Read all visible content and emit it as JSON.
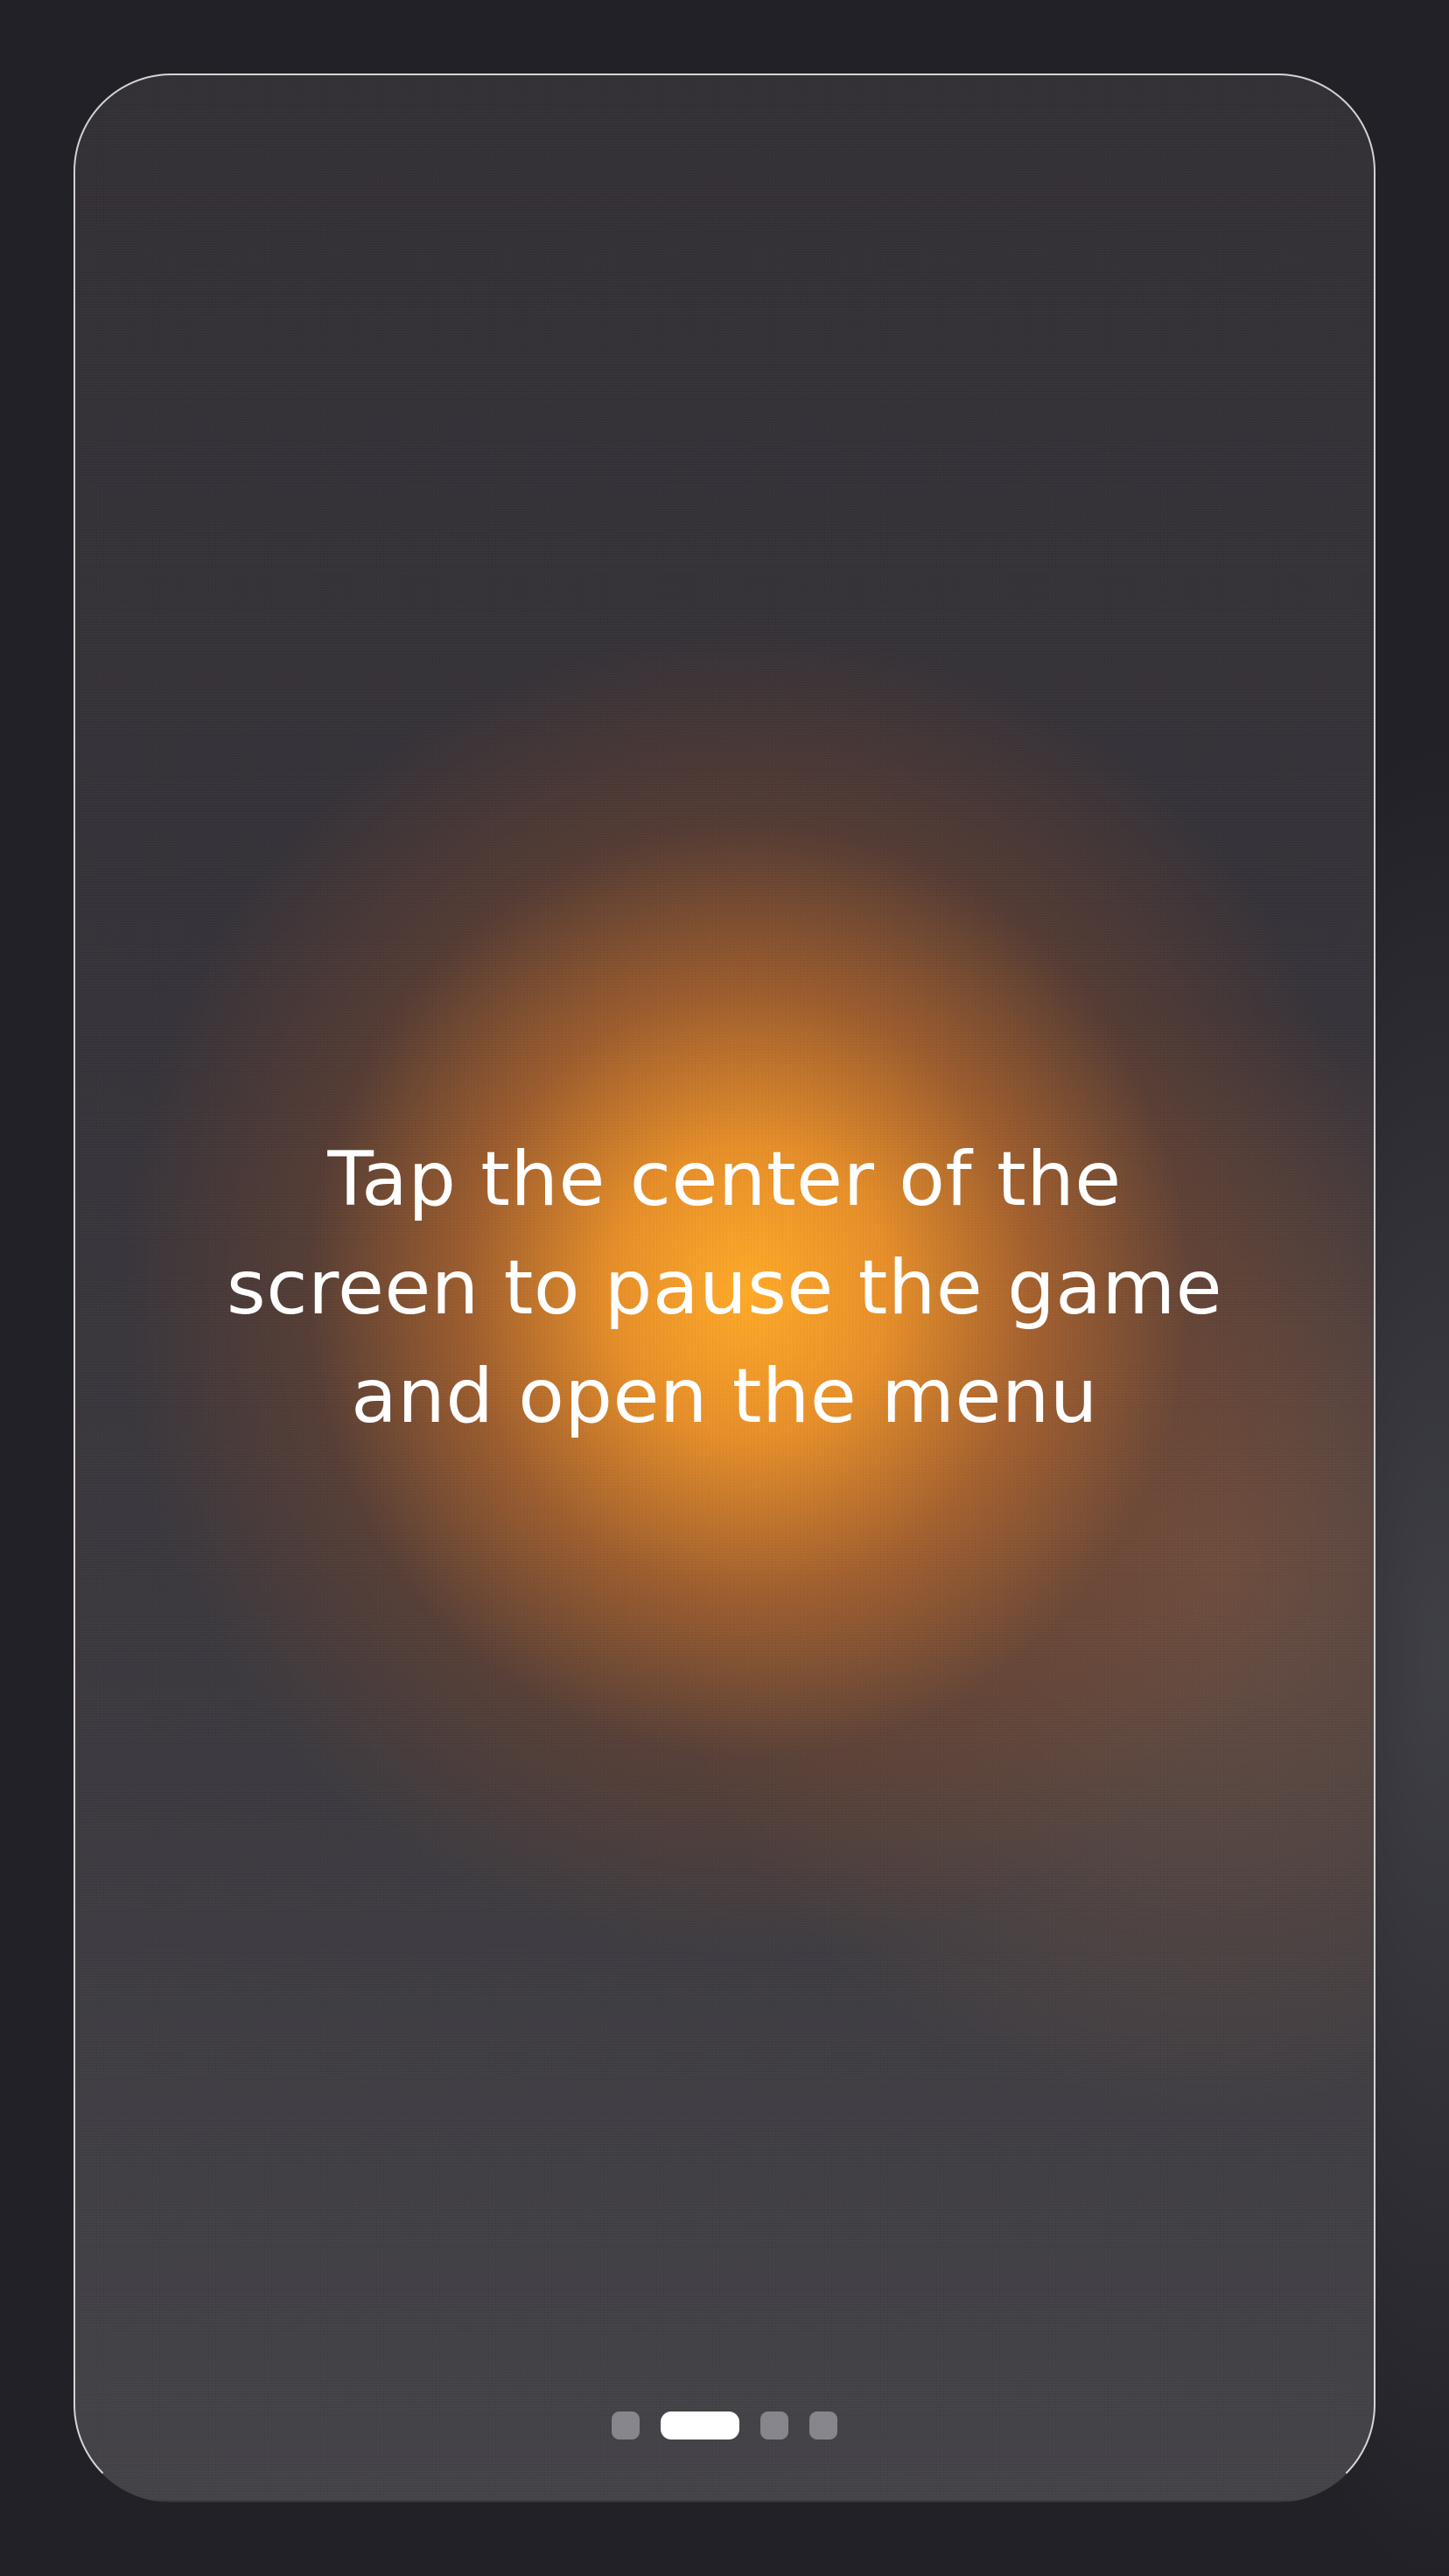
{
  "onboarding": {
    "message_lines": [
      "Tap the center of the",
      "screen to pause the game",
      "and open the menu"
    ]
  },
  "pager": {
    "total": 4,
    "active_index": 1
  },
  "colors": {
    "background": "#222127",
    "glow": "#f5a024",
    "text": "#ffffff",
    "dot_active": "#ffffff",
    "dot_inactive": "#8c8c92"
  }
}
